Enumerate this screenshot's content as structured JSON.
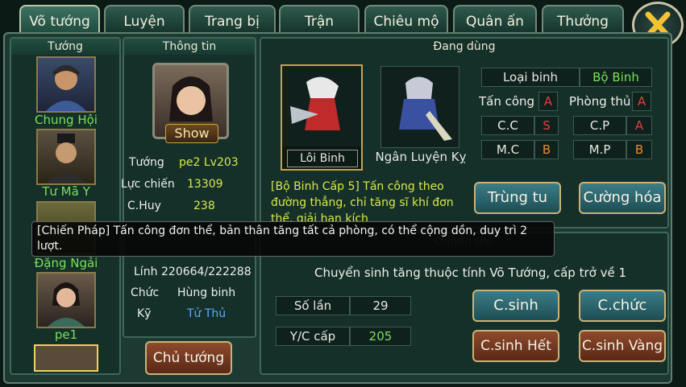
{
  "tabs": [
    "Võ tướng",
    "Luyện",
    "Trang bị",
    "Trận",
    "Chiêu mộ",
    "Quân ấn",
    "Thưởng"
  ],
  "left_panel": {
    "title": "Tướng",
    "generals": [
      "Chung Hội",
      "Tư Mã Y",
      "Đặng Ngải",
      "pe1"
    ]
  },
  "info_panel": {
    "title": "Thông tin",
    "show_button": "Show",
    "general_label": "Tướng",
    "general_value": "pe2 Lv203",
    "power_label": "Lực chiến",
    "power_value": "13309",
    "command_label": "C.Huy",
    "command_value": "238",
    "troops_label": "Lính",
    "troops_value": "220664/222288",
    "rank_label": "Chức",
    "rank_value": "Hùng binh",
    "skill_label": "Kỹ",
    "skill_value": "Tử Thủ",
    "main_button": "Chủ tướng"
  },
  "using_panel": {
    "title": "Đang dùng",
    "unit1": "Lôi Binh",
    "unit2": "Ngân Luyện Kỵ",
    "type_label": "Loại binh",
    "type_value": "Bộ Binh",
    "attack_label": "Tấn công",
    "attack_grade": "A",
    "defense_label": "Phòng thủ",
    "defense_grade": "A",
    "cc_label": "C.C",
    "cc_grade": "S",
    "cp_label": "C.P",
    "cp_grade": "A",
    "mc_label": "M.C",
    "mc_grade": "B",
    "mp_label": "M.P",
    "mp_grade": "B",
    "desc": "[Bộ Binh Cấp 5] Tấn công theo đường thẳng, chỉ tăng sĩ khí đơn thể, giải hạn kích",
    "train_button": "Trùng tu",
    "enhance_button": "Cường hóa"
  },
  "rebirth_panel": {
    "title": "Chuyển sinh",
    "desc": "Chuyển sinh tăng thuộc tính Võ Tướng, cấp trở về 1",
    "times_label": "Số lần",
    "times_value": "29",
    "level_label": "Y/C cấp",
    "level_value": "205",
    "btn_rebirth": "C.sinh",
    "btn_rank": "C.chức",
    "btn_rebirth_all": "C.sinh Hết",
    "btn_rebirth_gold": "C.sinh Vàng"
  },
  "tooltip": "[Chiến Pháp] Tấn công đơn thể, bản thân tăng tất cả phòng, có thể cộng dồn, duy trì 2 lượt."
}
